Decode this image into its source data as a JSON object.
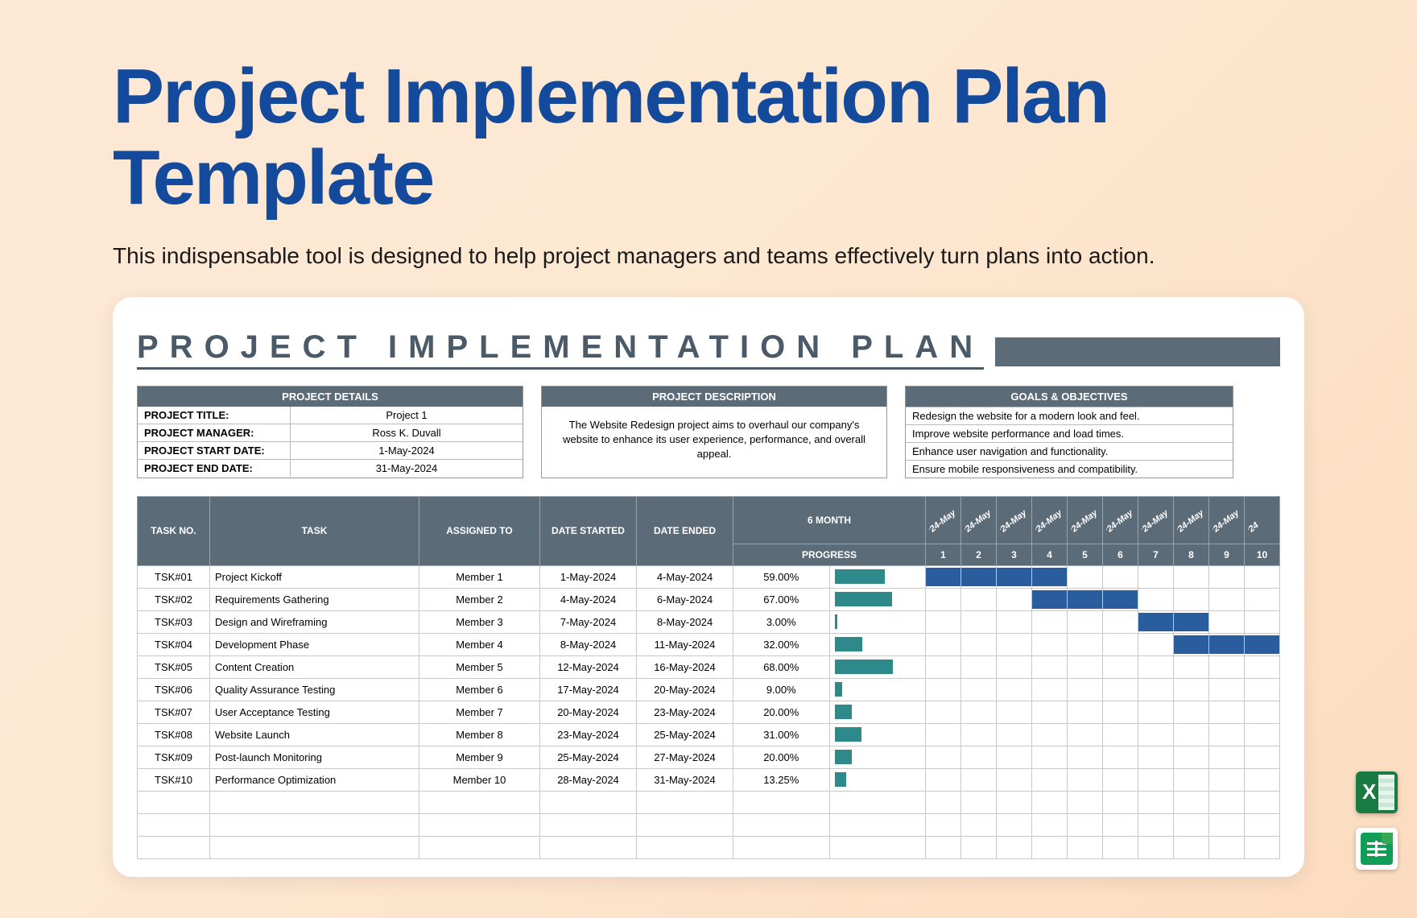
{
  "title": "Project Implementation Plan Template",
  "subtitle": "This indispensable tool is designed to help project managers and teams effectively turn plans into action.",
  "sheet_title": "PROJECT IMPLEMENTATION PLAN",
  "details": {
    "header": "PROJECT DETAILS",
    "rows": [
      {
        "k": "PROJECT TITLE:",
        "v": "Project 1"
      },
      {
        "k": "PROJECT MANAGER:",
        "v": "Ross K. Duvall"
      },
      {
        "k": "PROJECT START DATE:",
        "v": "1-May-2024"
      },
      {
        "k": "PROJECT END DATE:",
        "v": "31-May-2024"
      }
    ]
  },
  "description": {
    "header": "PROJECT DESCRIPTION",
    "body": "The Website Redesign project aims to overhaul our company's website to enhance its user experience, performance, and overall appeal."
  },
  "goals": {
    "header": "GOALS & OBJECTIVES",
    "items": [
      "Redesign the website for a modern look and feel.",
      "Improve website performance and load times.",
      "Enhance user navigation and functionality.",
      "Ensure mobile responsiveness and compatibility."
    ]
  },
  "columns": {
    "task_no": "TASK NO.",
    "task": "TASK",
    "assigned": "ASSIGNED TO",
    "started": "DATE STARTED",
    "ended": "DATE ENDED",
    "period": "6 MONTH",
    "progress": "PROGRESS"
  },
  "timeline_labels": [
    "'24-May",
    "'24-May",
    "'24-May",
    "'24-May",
    "'24-May",
    "'24-May",
    "'24-May",
    "'24-May",
    "'24-May",
    "'24"
  ],
  "day_numbers": [
    "1",
    "2",
    "3",
    "4",
    "5",
    "6",
    "7",
    "8",
    "9",
    "10"
  ],
  "tasks": [
    {
      "no": "TSK#01",
      "name": "Project Kickoff",
      "asg": "Member 1",
      "ds": "1-May-2024",
      "de": "4-May-2024",
      "pct": "59.00%",
      "pv": 59,
      "g": [
        1,
        1,
        1,
        1,
        0,
        0,
        0,
        0,
        0,
        0
      ]
    },
    {
      "no": "TSK#02",
      "name": "Requirements Gathering",
      "asg": "Member 2",
      "ds": "4-May-2024",
      "de": "6-May-2024",
      "pct": "67.00%",
      "pv": 67,
      "g": [
        0,
        0,
        0,
        1,
        1,
        1,
        0,
        0,
        0,
        0
      ]
    },
    {
      "no": "TSK#03",
      "name": "Design and Wireframing",
      "asg": "Member 3",
      "ds": "7-May-2024",
      "de": "8-May-2024",
      "pct": "3.00%",
      "pv": 3,
      "g": [
        0,
        0,
        0,
        0,
        0,
        0,
        1,
        1,
        0,
        0
      ]
    },
    {
      "no": "TSK#04",
      "name": "Development Phase",
      "asg": "Member 4",
      "ds": "8-May-2024",
      "de": "11-May-2024",
      "pct": "32.00%",
      "pv": 32,
      "g": [
        0,
        0,
        0,
        0,
        0,
        0,
        0,
        1,
        1,
        1
      ]
    },
    {
      "no": "TSK#05",
      "name": "Content Creation",
      "asg": "Member 5",
      "ds": "12-May-2024",
      "de": "16-May-2024",
      "pct": "68.00%",
      "pv": 68,
      "g": [
        0,
        0,
        0,
        0,
        0,
        0,
        0,
        0,
        0,
        0
      ]
    },
    {
      "no": "TSK#06",
      "name": "Quality Assurance Testing",
      "asg": "Member 6",
      "ds": "17-May-2024",
      "de": "20-May-2024",
      "pct": "9.00%",
      "pv": 9,
      "g": [
        0,
        0,
        0,
        0,
        0,
        0,
        0,
        0,
        0,
        0
      ]
    },
    {
      "no": "TSK#07",
      "name": "User Acceptance Testing",
      "asg": "Member 7",
      "ds": "20-May-2024",
      "de": "23-May-2024",
      "pct": "20.00%",
      "pv": 20,
      "g": [
        0,
        0,
        0,
        0,
        0,
        0,
        0,
        0,
        0,
        0
      ]
    },
    {
      "no": "TSK#08",
      "name": "Website Launch",
      "asg": "Member 8",
      "ds": "23-May-2024",
      "de": "25-May-2024",
      "pct": "31.00%",
      "pv": 31,
      "g": [
        0,
        0,
        0,
        0,
        0,
        0,
        0,
        0,
        0,
        0
      ]
    },
    {
      "no": "TSK#09",
      "name": "Post-launch Monitoring",
      "asg": "Member 9",
      "ds": "25-May-2024",
      "de": "27-May-2024",
      "pct": "20.00%",
      "pv": 20,
      "g": [
        0,
        0,
        0,
        0,
        0,
        0,
        0,
        0,
        0,
        0
      ]
    },
    {
      "no": "TSK#10",
      "name": "Performance Optimization",
      "asg": "Member 10",
      "ds": "28-May-2024",
      "de": "31-May-2024",
      "pct": "13.25%",
      "pv": 13.25,
      "g": [
        0,
        0,
        0,
        0,
        0,
        0,
        0,
        0,
        0,
        0
      ]
    }
  ],
  "icons": {
    "excel": "excel-icon",
    "sheets": "google-sheets-icon"
  }
}
